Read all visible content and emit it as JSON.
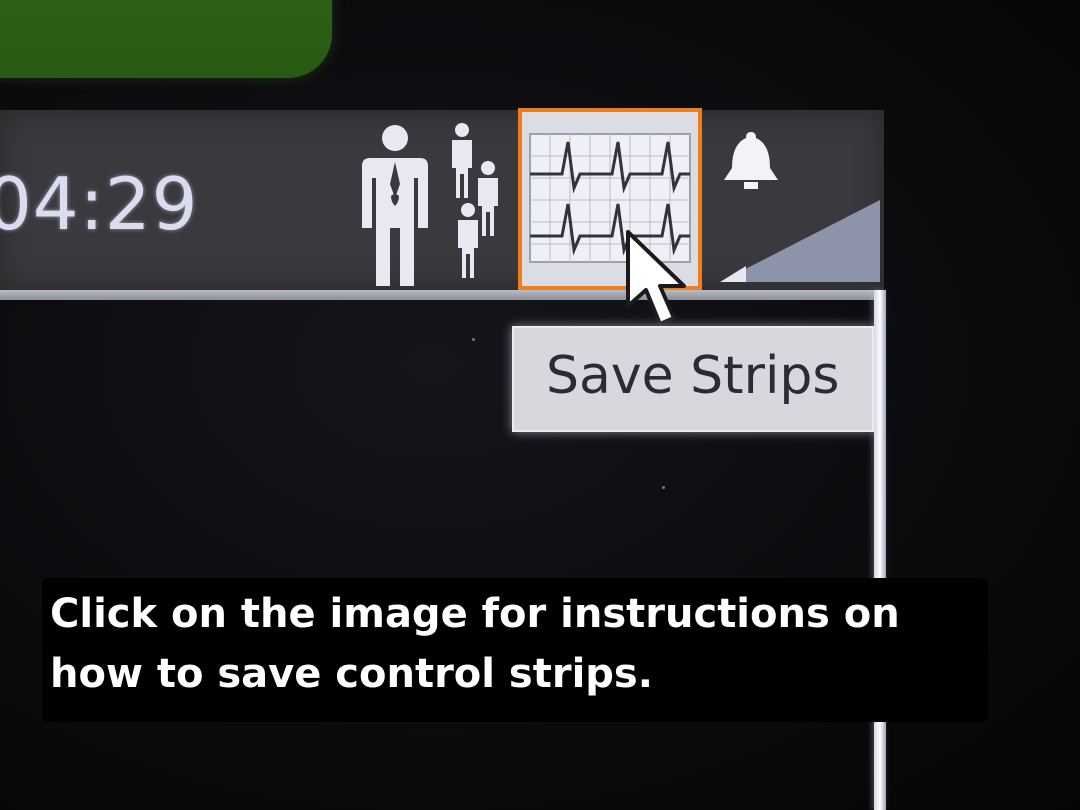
{
  "clock": {
    "time": "04:29"
  },
  "toolbar": {
    "icons": {
      "patient": "patient-icon",
      "group": "patient-group-icon",
      "save_strips": "ecg-strips-icon",
      "alarm": "alarm-bell-icon",
      "signal": "signal-strength-icon"
    }
  },
  "tooltip": {
    "text": "Save Strips"
  },
  "caption": {
    "text": "Click on the image for instructions on how to save control strips."
  },
  "colors": {
    "highlight_border": "#f07d1c",
    "toolbar_bg": "#3a3a3e",
    "tooltip_bg": "#d7d8dd",
    "green_tab": "#2f6518"
  }
}
